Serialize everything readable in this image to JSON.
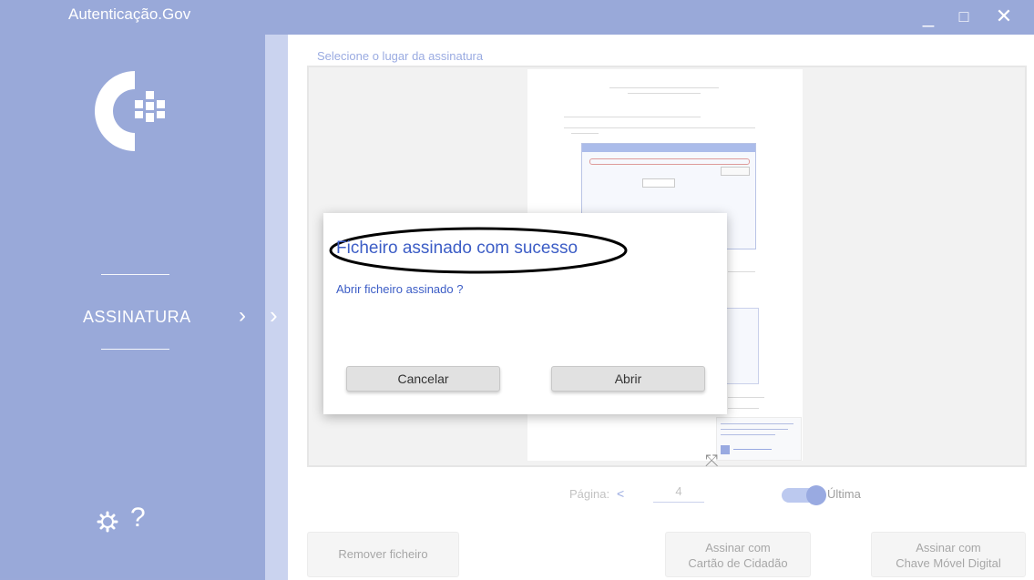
{
  "window": {
    "title": "Autenticação.Gov",
    "controls": {
      "minimize": "_",
      "maximize": "□",
      "close": "✕"
    }
  },
  "sidebar": {
    "nav_label": "ASSINATURA",
    "chevron": "›",
    "settings_icon": "gear-icon",
    "help_label": "?"
  },
  "main": {
    "section_title": "Selecione o lugar da assinatura",
    "page_label": "Página:",
    "page_prev": "<",
    "page_number": "4",
    "toggle_label": "Última",
    "toggle_on": true,
    "buttons": {
      "remove": "Remover ficheiro",
      "sign_card_line1": "Assinar com",
      "sign_card_line2": "Cartão de Cidadão",
      "sign_cmd_line1": "Assinar com",
      "sign_cmd_line2": "Chave Móvel Digital"
    }
  },
  "dialog": {
    "title": "Ficheiro assinado com sucesso",
    "question": "Abrir ficheiro assinado ?",
    "cancel": "Cancelar",
    "open": "Abrir"
  },
  "colors": {
    "brand": "#3d5ab7",
    "accent": "#3c5dc6",
    "strip": "#9aabe0"
  }
}
